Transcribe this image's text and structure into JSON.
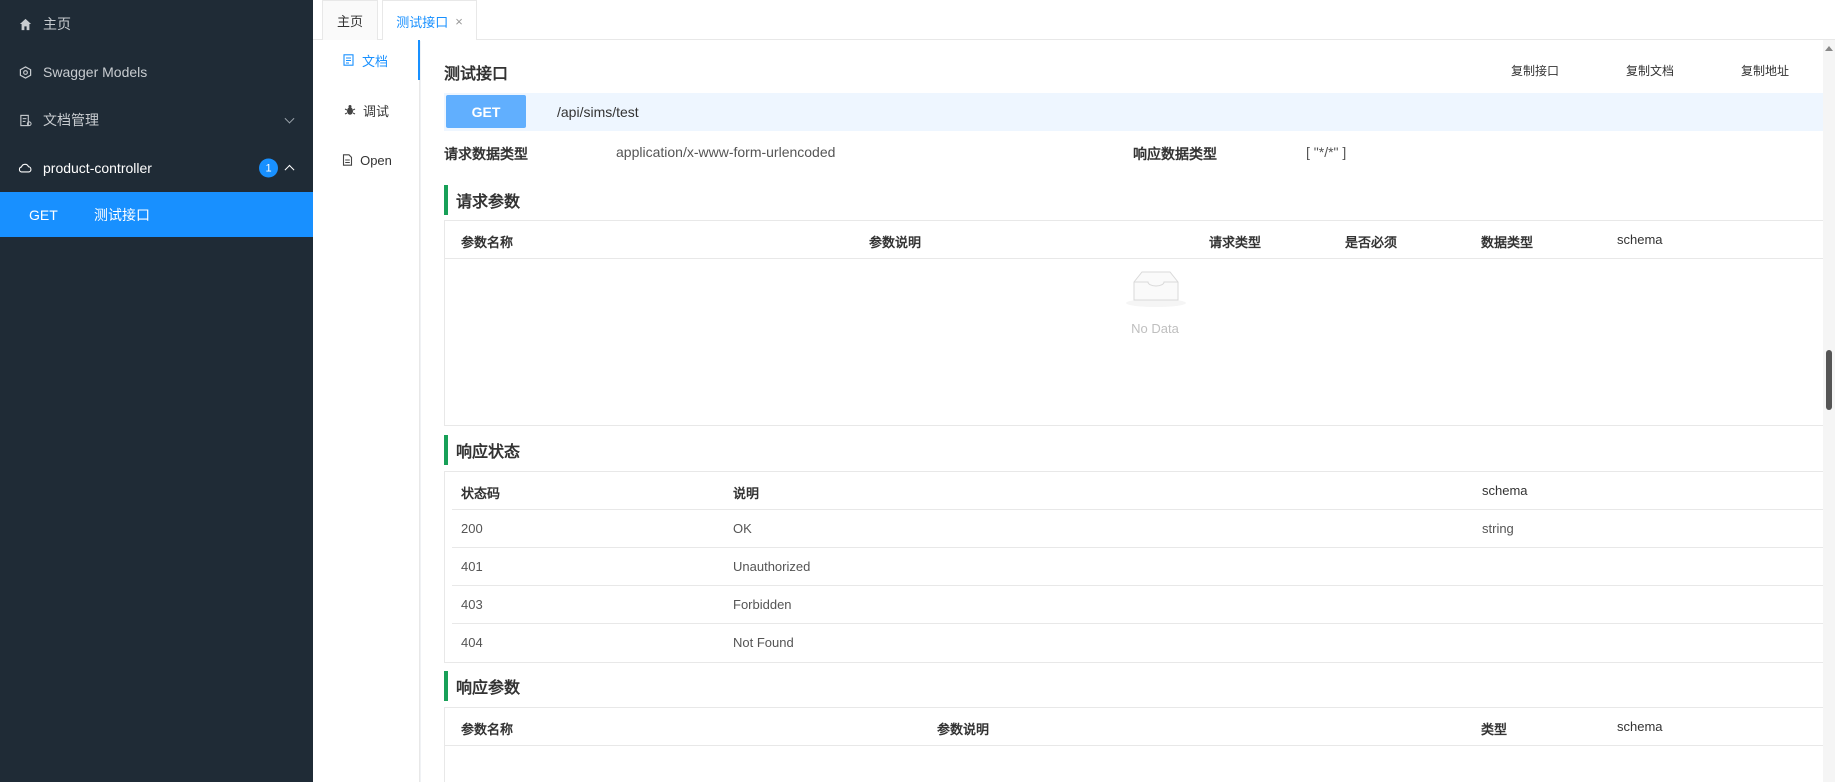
{
  "sidebar": {
    "items": [
      {
        "label": "主页",
        "icon": "home-icon"
      },
      {
        "label": "Swagger Models",
        "icon": "models-icon"
      },
      {
        "label": "文档管理",
        "icon": "doc-manage-icon"
      },
      {
        "label": "product-controller",
        "icon": "cloud-icon",
        "badge": "1"
      }
    ],
    "active_item": {
      "method": "GET",
      "label": "测试接口"
    }
  },
  "tabs": [
    {
      "label": "主页"
    },
    {
      "label": "测试接口",
      "close": "×"
    }
  ],
  "inner_nav": [
    {
      "label": "文档",
      "icon": "document-icon"
    },
    {
      "label": "调试",
      "icon": "bug-icon"
    },
    {
      "label": "Open",
      "icon": "file-icon"
    }
  ],
  "main": {
    "title": "测试接口",
    "copy_links": [
      "复制接口",
      "复制文档",
      "复制地址"
    ],
    "method": "GET",
    "path": "/api/sims/test",
    "request_type_label": "请求数据类型",
    "request_type_value": "application/x-www-form-urlencoded",
    "response_type_label": "响应数据类型",
    "response_type_value": "[ \"*/*\" ]"
  },
  "request_params": {
    "heading": "请求参数",
    "columns": [
      "参数名称",
      "参数说明",
      "请求类型",
      "是否必须",
      "数据类型",
      "schema"
    ],
    "empty_text": "No Data"
  },
  "response_status": {
    "heading": "响应状态",
    "columns": [
      "状态码",
      "说明",
      "schema"
    ],
    "rows": [
      {
        "code": "200",
        "desc": "OK",
        "schema": "string"
      },
      {
        "code": "401",
        "desc": "Unauthorized",
        "schema": ""
      },
      {
        "code": "403",
        "desc": "Forbidden",
        "schema": ""
      },
      {
        "code": "404",
        "desc": "Not Found",
        "schema": ""
      }
    ]
  },
  "response_params": {
    "heading": "响应参数",
    "columns": [
      "参数名称",
      "参数说明",
      "类型",
      "schema"
    ]
  },
  "colors": {
    "sidebar_bg": "#1f2b36",
    "accent": "#1890ff",
    "get_button": "#61affe",
    "section_marker": "#18a058"
  }
}
